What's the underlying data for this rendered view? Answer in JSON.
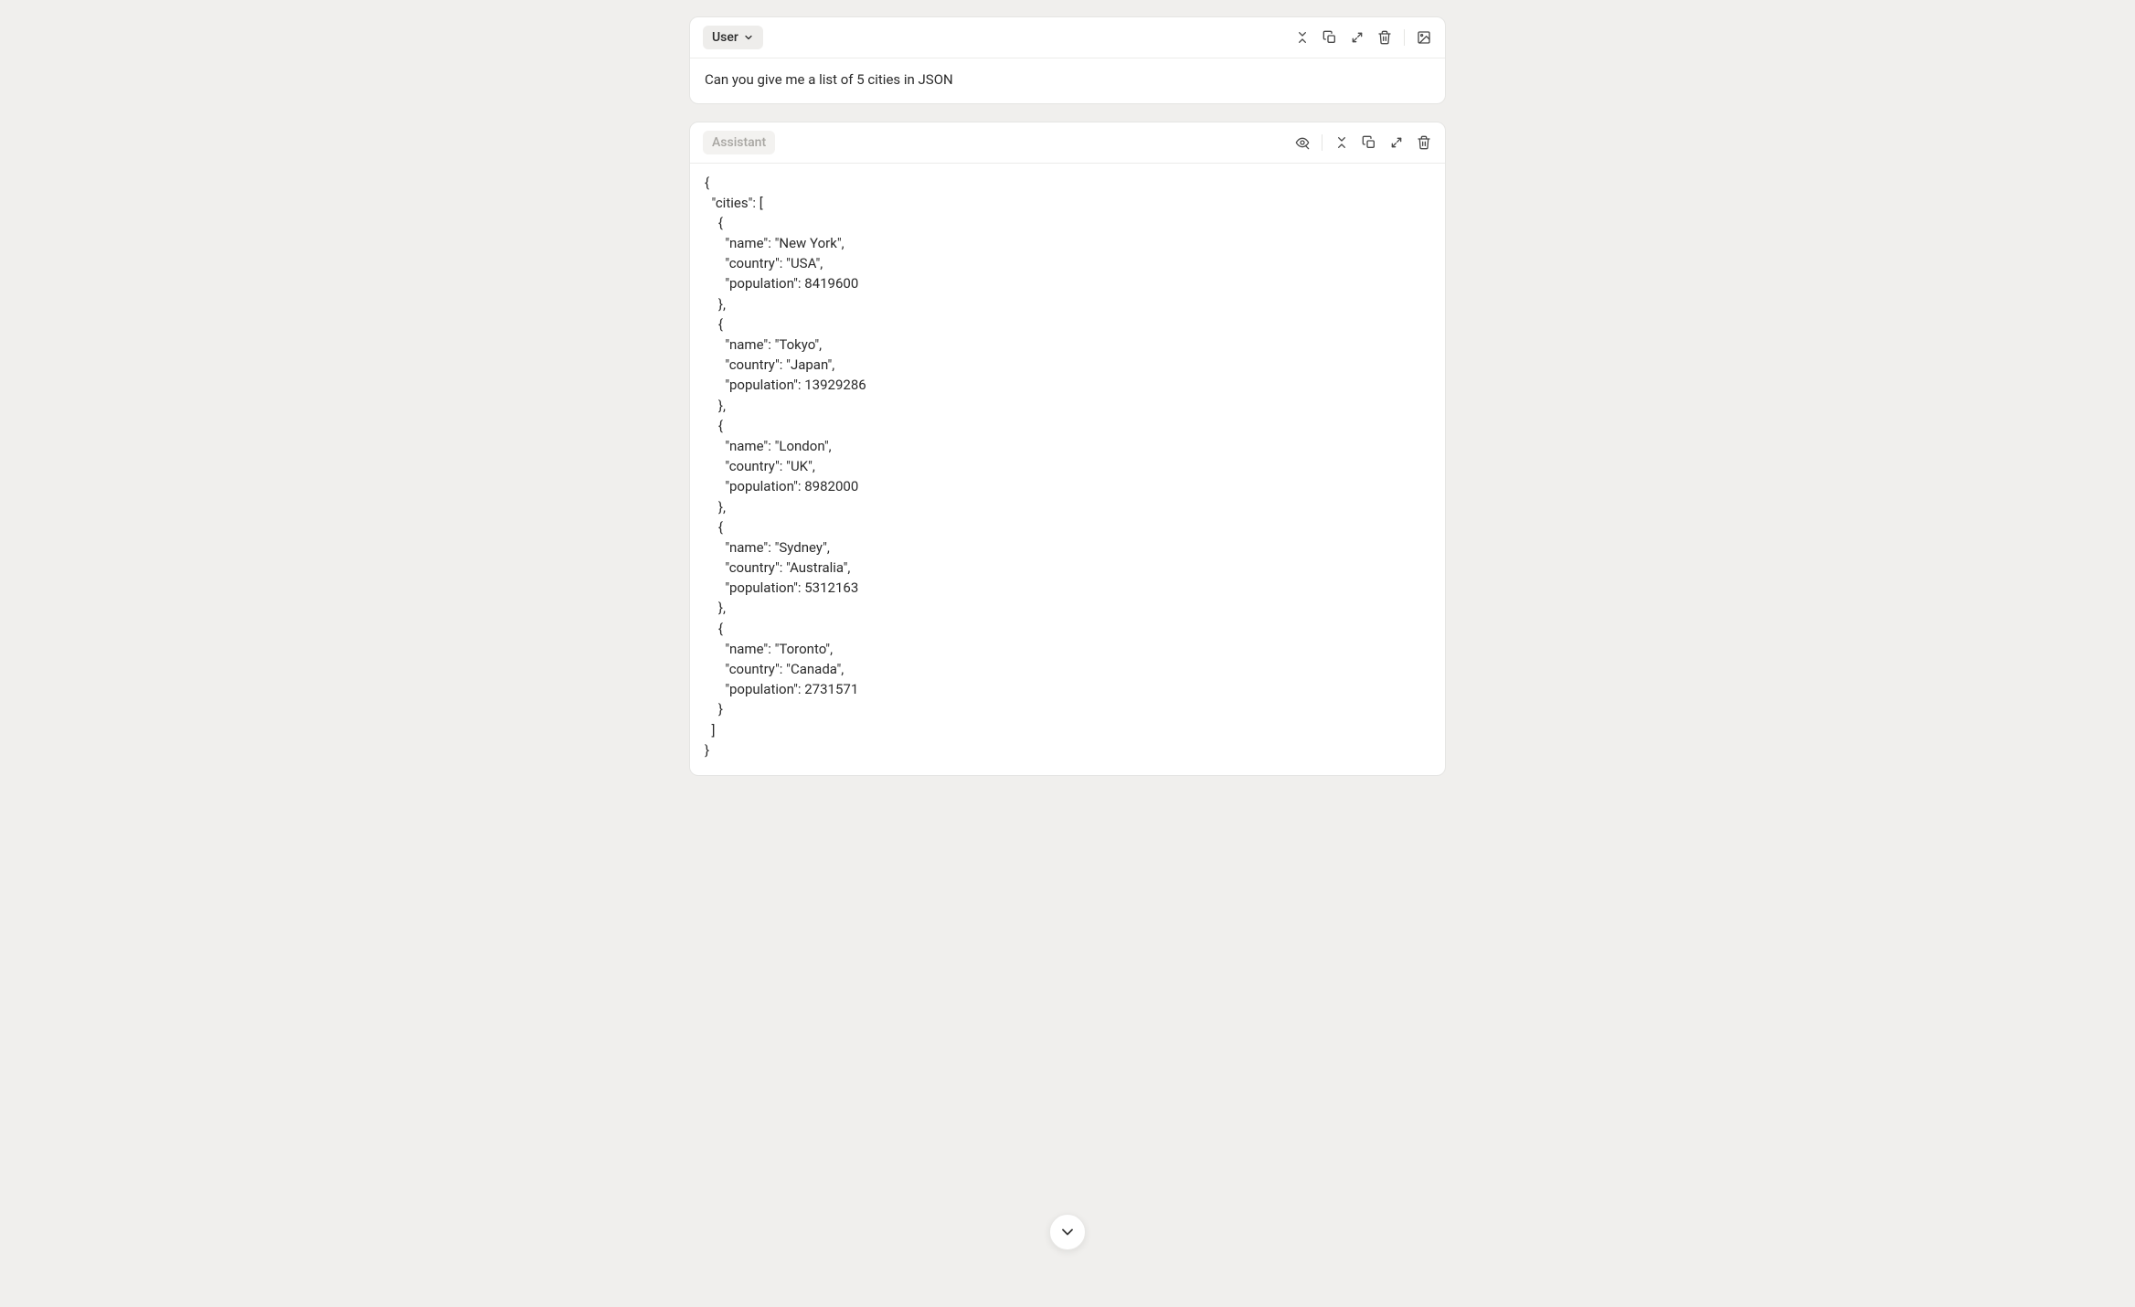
{
  "user_message": {
    "role_label": "User",
    "content": "Can you give me a list of 5 cities in JSON"
  },
  "assistant_message": {
    "role_label": "Assistant",
    "content": "{\n  \"cities\": [\n    {\n      \"name\": \"New York\",\n      \"country\": \"USA\",\n      \"population\": 8419600\n    },\n    {\n      \"name\": \"Tokyo\",\n      \"country\": \"Japan\",\n      \"population\": 13929286\n    },\n    {\n      \"name\": \"London\",\n      \"country\": \"UK\",\n      \"population\": 8982000\n    },\n    {\n      \"name\": \"Sydney\",\n      \"country\": \"Australia\",\n      \"population\": 5312163\n    },\n    {\n      \"name\": \"Toronto\",\n      \"country\": \"Canada\",\n      \"population\": 2731571\n    }\n  ]\n}"
  },
  "icons": {
    "collapse": "collapse-icon",
    "copy": "copy-icon",
    "expand": "expand-icon",
    "delete": "trash-icon",
    "image": "image-icon",
    "visibility": "eye-edit-icon",
    "chevron_down": "chevron-down-icon",
    "scroll_down": "chevron-down-icon"
  }
}
